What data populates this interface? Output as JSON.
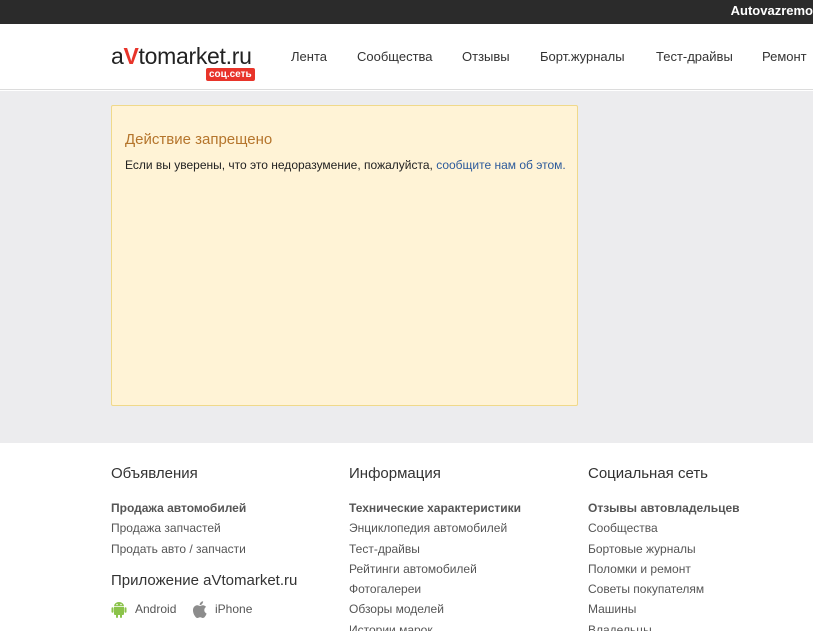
{
  "topbar": {
    "user_name": "Autovazremo"
  },
  "header": {
    "logo": {
      "part1": "a",
      "part2": "V",
      "part3": "tomarket.ru",
      "badge": "соц.сеть"
    },
    "nav": [
      {
        "label": "Лента"
      },
      {
        "label": "Сообщества"
      },
      {
        "label": "Отзывы"
      },
      {
        "label": "Борт.журналы"
      },
      {
        "label": "Тест-драйвы"
      },
      {
        "label": "Ремонт"
      }
    ]
  },
  "notice": {
    "title": "Действие запрещено",
    "text": "Если вы уверены, что это недоразумение, пожалуйста,",
    "link": "сообщите нам об этом."
  },
  "footer": {
    "col1": {
      "title": "Объявления",
      "items": [
        "Продажа автомобилей",
        "Продажа запчастей",
        "Продать авто / запчасти"
      ],
      "app_title": "Приложение aVtomarket.ru",
      "android": "Android",
      "iphone": "iPhone"
    },
    "col2": {
      "title": "Информация",
      "items": [
        "Технические характеристики",
        "Энциклопедия автомобилей",
        "Тест-драйвы",
        "Рейтинги автомобилей",
        "Фотогалереи",
        "Обзоры моделей",
        "Истории марок"
      ]
    },
    "col3": {
      "title": "Социальная сеть",
      "items": [
        "Отзывы автовладельцев",
        "Сообщества",
        "Бортовые журналы",
        "Поломки и ремонт",
        "Советы покупателям",
        "Машины",
        "Владельцы"
      ]
    }
  },
  "colors": {
    "topbar": "#2b2b2b",
    "accent": "#e8342a",
    "link": "#2c5a9b",
    "notice_bg": "#fff3d6",
    "notice_title": "#b5752c"
  }
}
